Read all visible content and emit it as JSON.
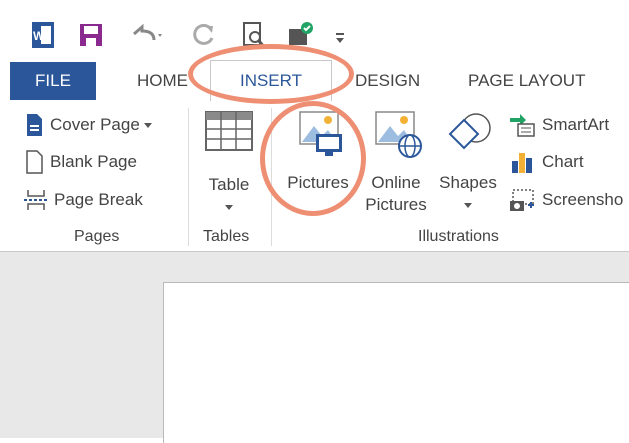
{
  "tabs": {
    "file": "FILE",
    "home": "HOME",
    "insert": "INSERT",
    "design": "DESIGN",
    "page_layout": "PAGE LAYOUT"
  },
  "pages_group": {
    "cover_page": "Cover Page",
    "blank_page": "Blank Page",
    "page_break": "Page Break",
    "label": "Pages"
  },
  "tables_group": {
    "table": "Table",
    "label": "Tables"
  },
  "illustrations_group": {
    "pictures": "Pictures",
    "online_pictures_line1": "Online",
    "online_pictures_line2": "Pictures",
    "shapes": "Shapes",
    "smartart": "SmartArt",
    "chart": "Chart",
    "screenshot": "Screensho",
    "label": "Illustrations"
  },
  "colors": {
    "word_blue": "#2b579a",
    "annotation": "#ee8f73"
  },
  "icons": [
    "word-app-icon",
    "save-icon",
    "undo-icon",
    "redo-icon",
    "print-preview-icon",
    "spelling-icon",
    "customize-qat-icon"
  ]
}
